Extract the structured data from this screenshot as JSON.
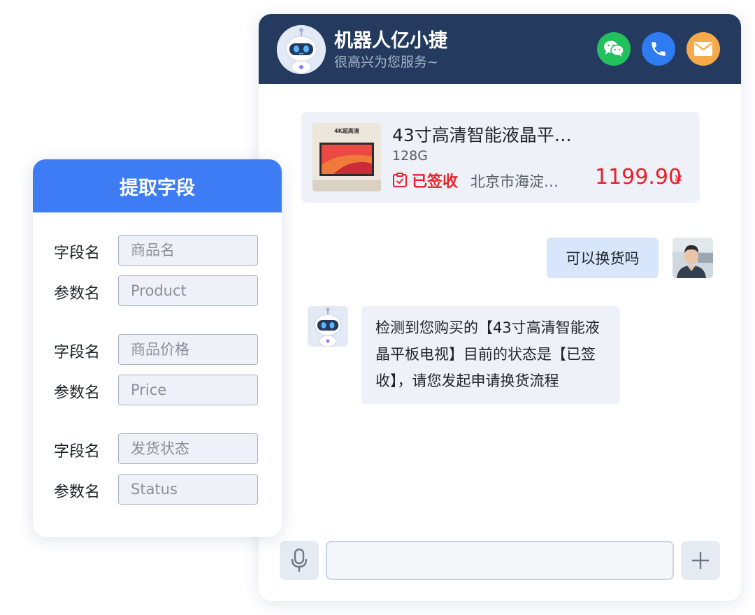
{
  "chat": {
    "bot_name": "机器人亿小捷",
    "bot_subtitle": "很高兴为您服务~",
    "header_buttons": [
      {
        "icon": "wechat-icon",
        "color": "#22c15e"
      },
      {
        "icon": "phone-icon",
        "color": "#2f7bf2"
      },
      {
        "icon": "mail-icon",
        "color": "#f8a94a"
      }
    ],
    "product": {
      "thumb_label": "4K超高清",
      "title": "43寸高清智能液晶平…",
      "spec": "128G",
      "status": "已签收",
      "address": "北京市海淀…",
      "price": "1199.90",
      "currency": "¥"
    },
    "user_message": "可以换货吗",
    "bot_message": "检测到您购买的【43寸高清智能液晶平板电视】目前的状态是【已签收】，请您发起申请换货流程",
    "input": {
      "value": "",
      "placeholder": ""
    }
  },
  "panel": {
    "title": "提取字段",
    "field_label": "字段名",
    "param_label": "参数名",
    "fields": [
      {
        "field_placeholder": "商品名",
        "param_placeholder": "Product"
      },
      {
        "field_placeholder": "商品价格",
        "param_placeholder": "Price"
      },
      {
        "field_placeholder": "发货状态",
        "param_placeholder": "Status"
      }
    ]
  },
  "colors": {
    "header_bg": "#243a5e",
    "panel_header": "#3e7cf6",
    "price_red": "#e6222c",
    "user_bubble": "#d7e6fb",
    "bot_bubble": "#eef1f7"
  }
}
